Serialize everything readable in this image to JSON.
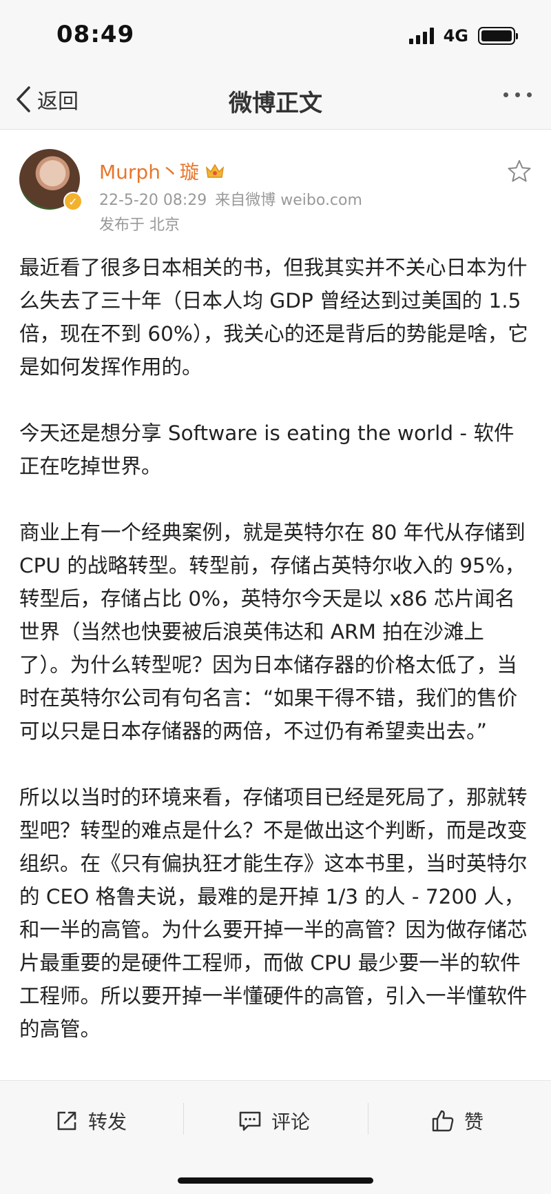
{
  "status_bar": {
    "time": "08:49",
    "network": "4G"
  },
  "nav": {
    "back_label": "返回",
    "title": "微博正文"
  },
  "post": {
    "username": "Murph丶璇",
    "date": "22-5-20 08:29",
    "source": "来自微博 weibo.com",
    "location": "发布于 北京",
    "paragraphs": [
      "最近看了很多日本相关的书，但我其实并不关心日本为什么失去了三十年（日本人均 GDP 曾经达到过美国的 1.5 倍，现在不到 60%），我关心的还是背后的势能是啥，它是如何发挥作用的。",
      "今天还是想分享 Software is eating the world - 软件正在吃掉世界。",
      "商业上有一个经典案例，就是英特尔在 80 年代从存储到 CPU 的战略转型。转型前，存储占英特尔收入的 95%，转型后，存储占比 0%，英特尔今天是以 x86 芯片闻名世界（当然也快要被后浪英伟达和 ARM 拍在沙滩上了）。为什么转型呢？因为日本储存器的价格太低了，当时在英特尔公司有句名言：“如果干得不错，我们的售价可以只是日本存储器的两倍，不过仍有希望卖出去。”",
      "所以以当时的环境来看，存储项目已经是死局了，那就转型吧？转型的难点是什么？不是做出这个判断，而是改变组织。在《只有偏执狂才能生存》这本书里，当时英特尔的 CEO 格鲁夫说，最难的是开掉 1/3 的人 - 7200 人，和一半的高管。为什么要开掉一半的高管？因为做存储芯片最重要的是硬件工程师，而做 CPU 最少要一半的软件工程师。所以要开掉一半懂硬件的高管，引入一半懂软件的高管。"
    ]
  },
  "actions": {
    "repost": "转发",
    "comment": "评论",
    "like": "赞"
  },
  "colors": {
    "username": "#e7762b",
    "meta": "#999999",
    "bar_bg": "#f7f7f7"
  }
}
